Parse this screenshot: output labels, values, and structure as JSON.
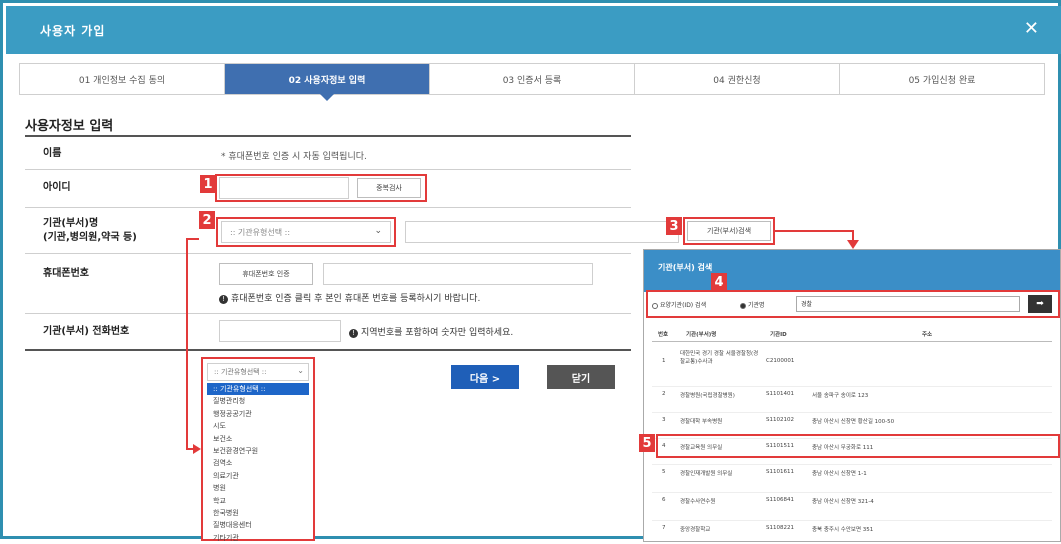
{
  "window": {
    "title": "사용자 가입",
    "close_icon": "close-icon"
  },
  "steps": [
    {
      "label": "01 개인정보 수집 동의",
      "active": false
    },
    {
      "label": "02 사용자정보 입력",
      "active": true
    },
    {
      "label": "03 인증서 등록",
      "active": false
    },
    {
      "label": "04 권한신청",
      "active": false
    },
    {
      "label": "05 가입신청 완료",
      "active": false
    }
  ],
  "form": {
    "section_title": "사용자정보 입력",
    "name": {
      "label": "이름",
      "note": "* 휴대폰번호 인증 시 자동 입력됩니다."
    },
    "id": {
      "label": "아이디",
      "value": "",
      "check_button": "중복검사"
    },
    "org": {
      "label_line1": "기관(부서)명",
      "label_line2": "(기관,병의원,약국 등)",
      "select_value": ":: 기관유형선택 ::",
      "input_value": "",
      "search_button": "기관(부서)검색"
    },
    "phone": {
      "label": "휴대폰번호",
      "verify_button": "휴대폰번호 인증",
      "input_value": "",
      "note": "휴대폰번호 인증 클릭 후 본인 휴대폰 번호를 등록하시기 바랍니다."
    },
    "tel": {
      "label": "기관(부서) 전화번호",
      "input_value": "",
      "note": "지역번호를 포함하여 숫자만 입력하세요."
    },
    "next_button": "다음 >",
    "close_button": "닫기"
  },
  "dropdown": {
    "header": ":: 기관유형선택 ::",
    "options": [
      ":: 기관유형선택 ::",
      "질병관리청",
      "행정공공기관",
      "시도",
      "보건소",
      "보건환경연구원",
      "검역소",
      "의료기관",
      "병원",
      "학교",
      "한국병원",
      "질병대응센터",
      "기타기관"
    ],
    "selected_index": 0
  },
  "badges": [
    "1",
    "2",
    "3",
    "4",
    "5"
  ],
  "popup": {
    "title": "기관(부서) 검색",
    "radio_1": "요양기관(ID) 검색",
    "radio_2": "기관명",
    "search_value": "경찰",
    "search_button": "➡",
    "headers": [
      "번호",
      "기관(부서)명",
      "기관ID",
      "주소"
    ],
    "rows": [
      {
        "no": "1",
        "name": "대한민국 경기 경찰 서울경찰청(경찰교통)수사과",
        "id": "C2100001",
        "addr": ""
      },
      {
        "no": "2",
        "name": "경찰병원(국립경찰병원)",
        "id": "S1101401",
        "addr": "서울 송파구 송이로 123"
      },
      {
        "no": "3",
        "name": "경찰대학 부속병원",
        "id": "S1102102",
        "addr": "충남 아산시 신창면 황산길 100-50"
      },
      {
        "no": "4",
        "name": "경찰교육원 의무실",
        "id": "S1101511",
        "addr": "충남 아산시 무궁화로 111"
      },
      {
        "no": "5",
        "name": "경찰인재개발원 의무실",
        "id": "S1101611",
        "addr": "충남 아산시 신창면 1-1"
      },
      {
        "no": "6",
        "name": "경찰수사연수원",
        "id": "S1106841",
        "addr": "충남 아산시 신창면 321-4"
      },
      {
        "no": "7",
        "name": "중앙경찰학교",
        "id": "S1108221",
        "addr": "충북 충주시 수안보면 351"
      }
    ],
    "highlight_row": 3
  },
  "colors": {
    "titlebar": "#3b9cc3",
    "active_step": "#3f6fb0",
    "accent_red": "#e23a3a",
    "next_button": "#1f5fb8",
    "close_button": "#555555"
  }
}
